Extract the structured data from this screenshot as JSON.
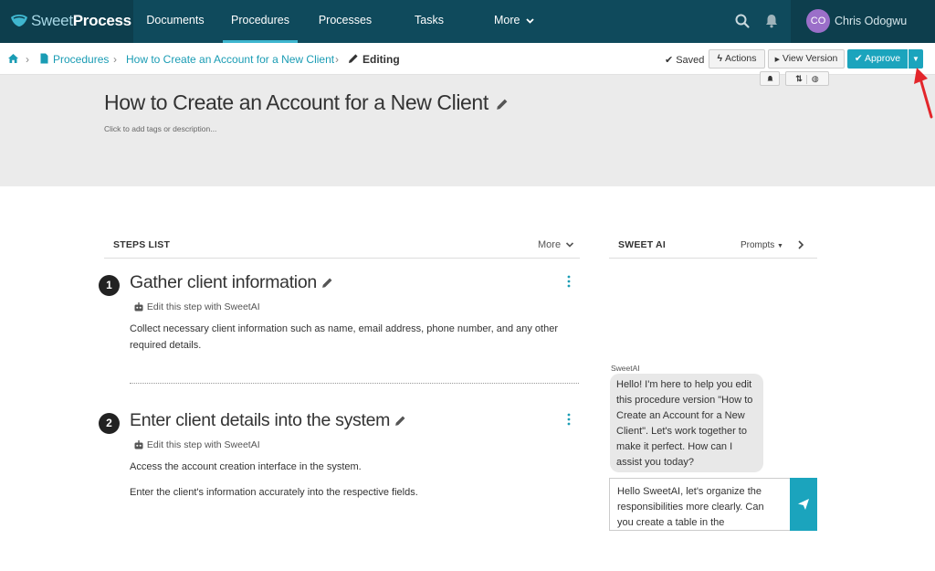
{
  "brand": {
    "name_light": "Sweet",
    "name_bold": "Process"
  },
  "nav": {
    "items": [
      {
        "label": "Documents"
      },
      {
        "label": "Procedures"
      },
      {
        "label": "Processes"
      },
      {
        "label": "Tasks"
      },
      {
        "label": "More"
      }
    ],
    "user": {
      "initials": "CO",
      "name": "Chris Odogwu"
    }
  },
  "breadcrumb": {
    "procedures": "Procedures",
    "procedure": "How to Create an Account for a New Client",
    "current": "Editing"
  },
  "toolbar": {
    "saved": "Saved",
    "actions": "Actions",
    "view_version": "View Version",
    "approve": "Approve"
  },
  "header": {
    "title": "How to Create an Account for a New Client",
    "tags_hint": "Click to add tags or description..."
  },
  "steps_list": {
    "heading": "STEPS LIST",
    "more": "More",
    "steps": [
      {
        "number": "1",
        "title": "Gather client information",
        "edit_ai": "Edit this step with SweetAI",
        "paragraphs": [
          "Collect necessary client information such as name, email address, phone number, and any other required details."
        ]
      },
      {
        "number": "2",
        "title": "Enter client details into the system",
        "edit_ai": "Edit this step with SweetAI",
        "paragraphs": [
          "Access the account creation interface in the system.",
          "Enter the client's information accurately into the respective fields."
        ]
      }
    ]
  },
  "sweet_ai": {
    "heading": "SWEET AI",
    "prompts": "Prompts",
    "sender": "SweetAI",
    "message": "Hello! I'm here to help you edit this procedure version \"How to Create an Account for a New Client\". Let's work together to make it perfect. How can I assist you today?",
    "input_value": "Hello SweetAI, let's organize the responsibilities more clearly. Can you create a table in the"
  },
  "colors": {
    "nav_bg": "#0f4a5c",
    "accent": "#1ba4bd",
    "link": "#1a9cb4",
    "avatar": "#9b6fc9",
    "annotation_arrow": "#e3262b"
  }
}
